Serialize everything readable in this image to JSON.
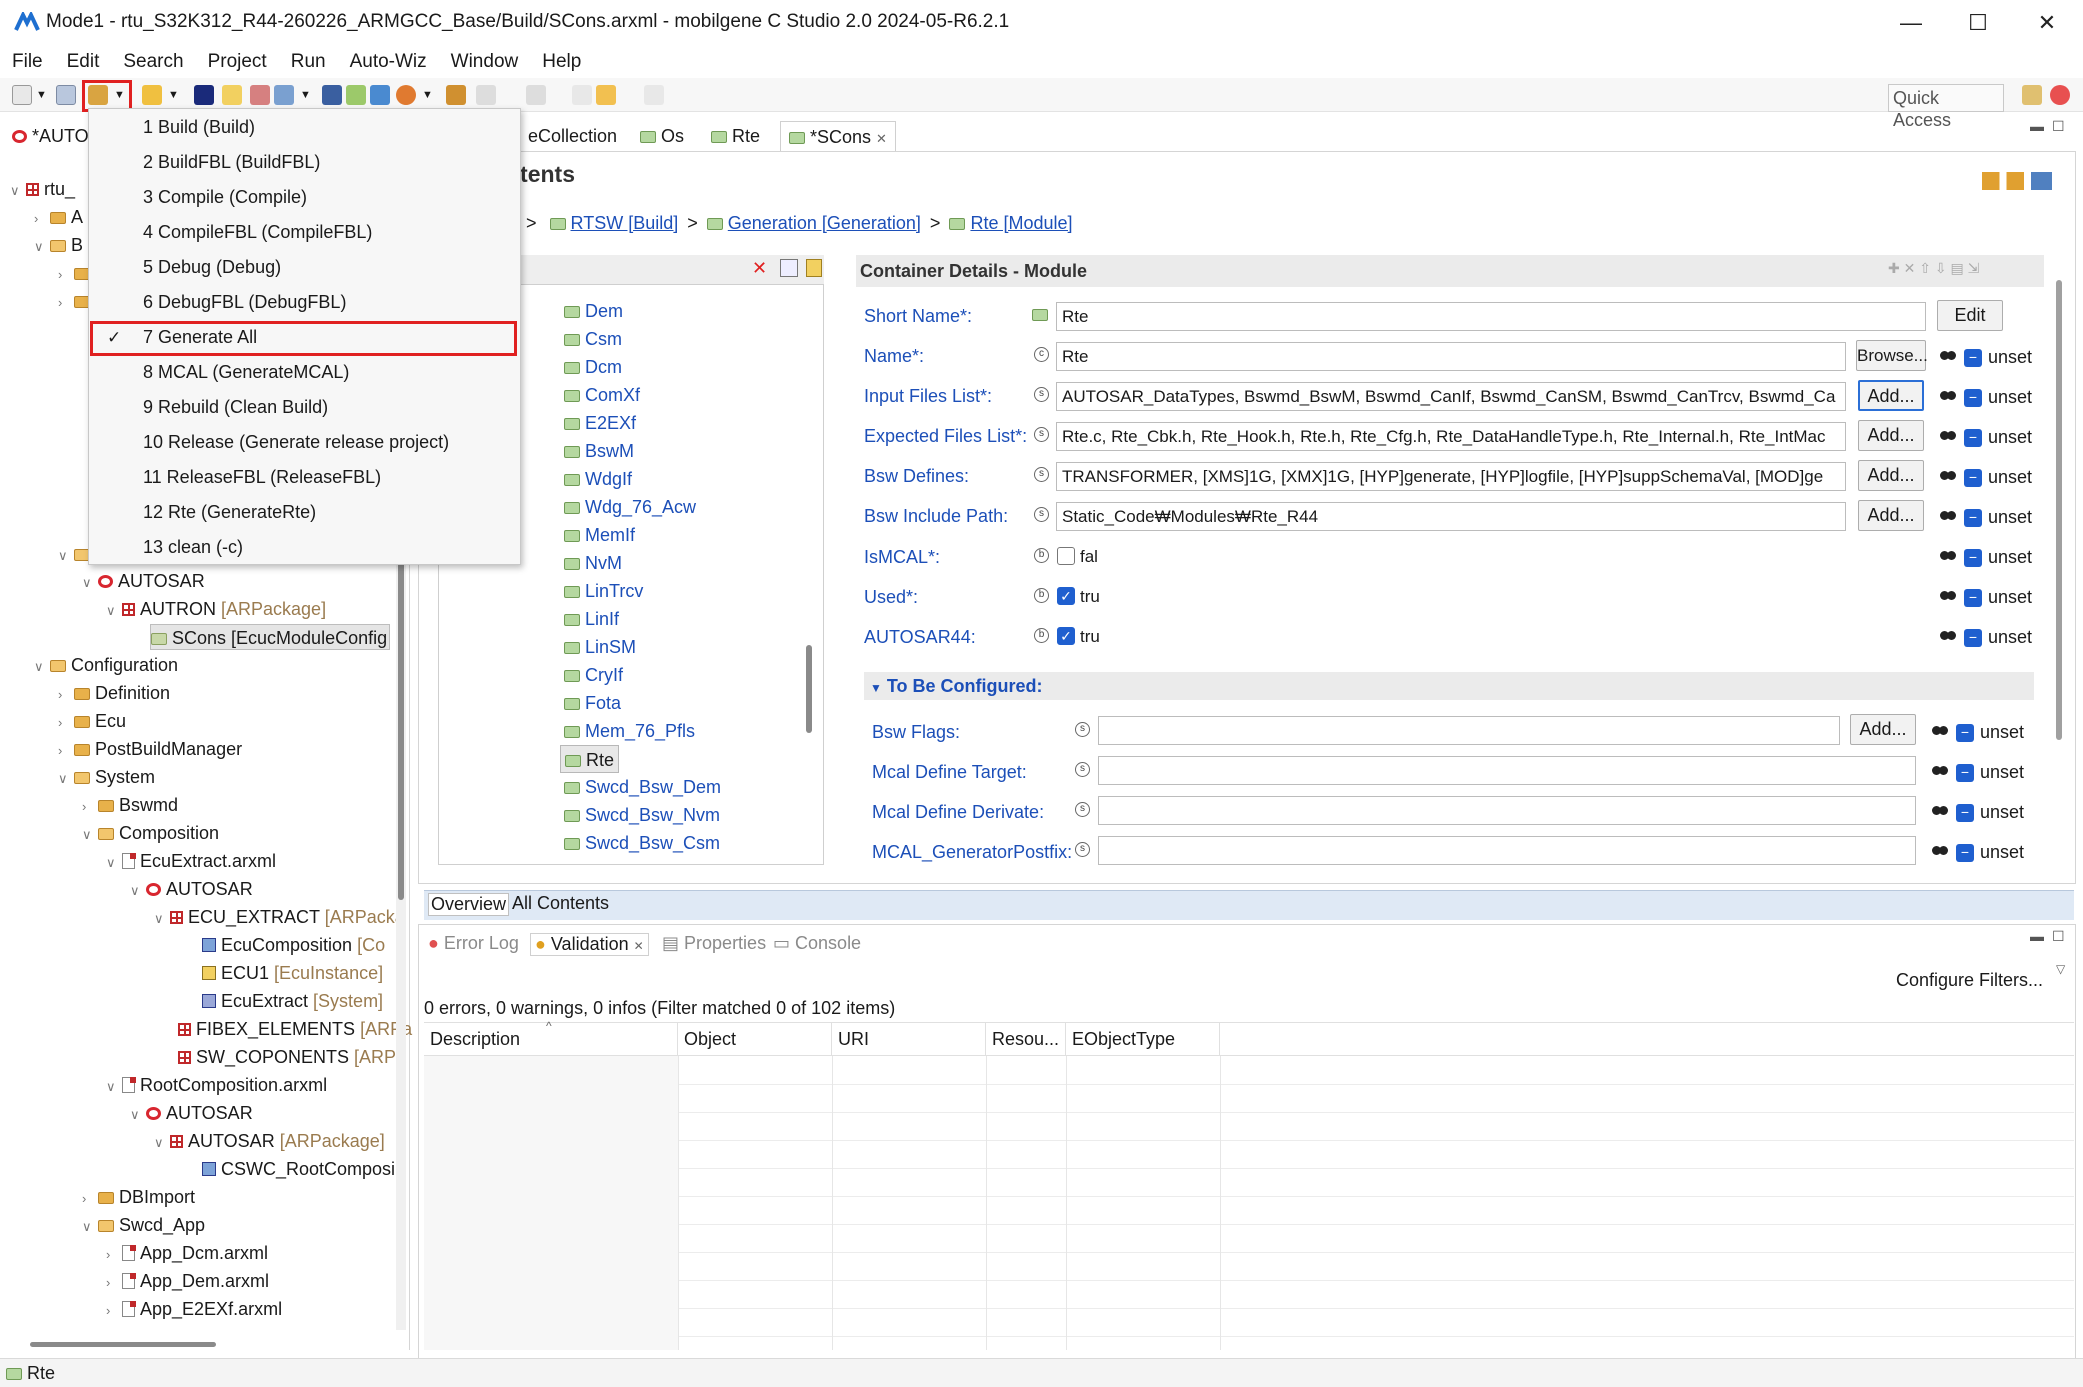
{
  "window": {
    "title": "Mode1 - rtu_S32K312_R44-260226_ARMGCC_Base/Build/SCons.arxml - mobilgene C Studio 2.0 2024-05-R6.2.1",
    "controls": [
      "—",
      "☐",
      "✕"
    ]
  },
  "menu": [
    "File",
    "Edit",
    "Search",
    "Project",
    "Run",
    "Auto-Wiz",
    "Window",
    "Help"
  ],
  "quick_access": "Quick Access",
  "build_menu": {
    "items": [
      "1 Build (Build)",
      "2 BuildFBL (BuildFBL)",
      "3 Compile (Compile)",
      "4 CompileFBL (CompileFBL)",
      "5 Debug (Debug)",
      "6 DebugFBL (DebugFBL)",
      "7 Generate All",
      "8 MCAL (GenerateMCAL)",
      "9 Rebuild (Clean  Build)",
      "10 Release (Generate release project)",
      "11 ReleaseFBL (ReleaseFBL)",
      "12 Rte (GenerateRte)",
      "13 clean (-c)"
    ],
    "checked_index": 6,
    "check_mark": "✓"
  },
  "left_tab": "*AUTO",
  "tree": {
    "partial": [
      "rtu_",
      "A",
      "B"
    ],
    "rows": [
      {
        "label": "AUTOSAR",
        "suffix": ""
      },
      {
        "label": "AUTRON",
        "suffix": "[ARPackage]"
      },
      {
        "label": "SCons [EcucModuleConfig",
        "suffix": ""
      },
      {
        "label": "Configuration",
        "suffix": ""
      },
      {
        "label": "Definition",
        "suffix": ""
      },
      {
        "label": "Ecu",
        "suffix": ""
      },
      {
        "label": "PostBuildManager",
        "suffix": ""
      },
      {
        "label": "System",
        "suffix": ""
      },
      {
        "label": "Bswmd",
        "suffix": ""
      },
      {
        "label": "Composition",
        "suffix": ""
      },
      {
        "label": "EcuExtract.arxml",
        "suffix": ""
      },
      {
        "label": "AUTOSAR",
        "suffix": ""
      },
      {
        "label": "ECU_EXTRACT",
        "suffix": "[ARPacka"
      },
      {
        "label": "EcuComposition",
        "suffix": "[Co"
      },
      {
        "label": "ECU1",
        "suffix": "[EcuInstance]"
      },
      {
        "label": "EcuExtract",
        "suffix": "[System]"
      },
      {
        "label": "FIBEX_ELEMENTS",
        "suffix": "[ARPa"
      },
      {
        "label": "SW_COPONENTS",
        "suffix": "[ARPa"
      },
      {
        "label": "RootComposition.arxml",
        "suffix": ""
      },
      {
        "label": "AUTOSAR",
        "suffix": ""
      },
      {
        "label": "AUTOSAR",
        "suffix": "[ARPackage]"
      },
      {
        "label": "CSWC_RootComposi",
        "suffix": ""
      },
      {
        "label": "DBImport",
        "suffix": ""
      },
      {
        "label": "Swcd_App",
        "suffix": ""
      },
      {
        "label": "App_Dcm.arxml",
        "suffix": ""
      },
      {
        "label": "App_Dem.arxml",
        "suffix": ""
      },
      {
        "label": "App_E2EXf.arxml",
        "suffix": ""
      }
    ]
  },
  "editor_tabs": [
    "eCollection",
    "Os",
    "Rte",
    "*SCons"
  ],
  "editor": {
    "section_title": "ntents",
    "breadcrumb": [
      "RTSW [Build]",
      "Generation [Generation]",
      "Rte [Module]"
    ],
    "breadcrumb_sep": ">",
    "modules": [
      "Dem",
      "Csm",
      "Dcm",
      "ComXf",
      "E2EXf",
      "BswM",
      "WdgIf",
      "Wdg_76_Acw",
      "MemIf",
      "NvM",
      "LinTrcv",
      "LinIf",
      "LinSM",
      "CryIf",
      "Fota",
      "Mem_76_Pfls",
      "Rte",
      "Swcd_Bsw_Dem",
      "Swcd_Bsw_Nvm",
      "Swcd_Bsw_Csm"
    ],
    "selected_module": "Rte",
    "details_title": "Container Details - Module",
    "fields": [
      {
        "label": "Short Name*:",
        "value": "Rte",
        "button": "Edit",
        "unset": ""
      },
      {
        "label": "Name*:",
        "value": "Rte",
        "button": "Browse...",
        "unset": "unset"
      },
      {
        "label": "Input Files List*:",
        "value": "AUTOSAR_DataTypes, Bswmd_BswM, Bswmd_CanIf, Bswmd_CanSM, Bswmd_CanTrcv, Bswmd_Ca",
        "button": "Add...",
        "unset": "unset"
      },
      {
        "label": "Expected Files List*:",
        "value": "Rte.c, Rte_Cbk.h, Rte_Hook.h, Rte.h, Rte_Cfg.h, Rte_DataHandleType.h, Rte_Internal.h, Rte_IntMac",
        "button": "Add...",
        "unset": "unset"
      },
      {
        "label": "Bsw Defines:",
        "value": "TRANSFORMER, [XMS]1G, [XMX]1G, [HYP]generate, [HYP]logfile, [HYP]suppSchemaVal, [MOD]ge",
        "button": "Add...",
        "unset": "unset"
      },
      {
        "label": "Bsw Include Path:",
        "value": "Static_Code₩Modules₩Rte_R44",
        "button": "Add...",
        "unset": "unset"
      }
    ],
    "checks": [
      {
        "label": "IsMCAL*:",
        "value": "fal",
        "checked": false,
        "unset": "unset"
      },
      {
        "label": "Used*:",
        "value": "tru",
        "checked": true,
        "unset": "unset"
      },
      {
        "label": "AUTOSAR44:",
        "value": "tru",
        "checked": true,
        "unset": "unset"
      }
    ],
    "to_be_configured": "To Be Configured:",
    "config_fields": [
      {
        "label": "Bsw Flags:",
        "value": "",
        "button": "Add...",
        "unset": "unset"
      },
      {
        "label": "Mcal Define Target:",
        "value": "",
        "unset": "unset"
      },
      {
        "label": "Mcal Define Derivate:",
        "value": "",
        "unset": "unset"
      },
      {
        "label": "MCAL_GeneratorPostfix:",
        "value": "",
        "unset": "unset"
      }
    ],
    "bottom_tabs": [
      "Overview",
      "All Contents"
    ]
  },
  "bottom_panel": {
    "tabs": [
      "Error Log",
      "Validation",
      "Properties",
      "Console"
    ],
    "selected": "Validation",
    "configure_filters": "Configure Filters...",
    "summary": "0 errors, 0 warnings, 0 infos (Filter matched 0 of 102 items)",
    "columns": [
      "Description",
      "Object",
      "URI",
      "Resou...",
      "EObjectType"
    ]
  },
  "status": "Rte"
}
